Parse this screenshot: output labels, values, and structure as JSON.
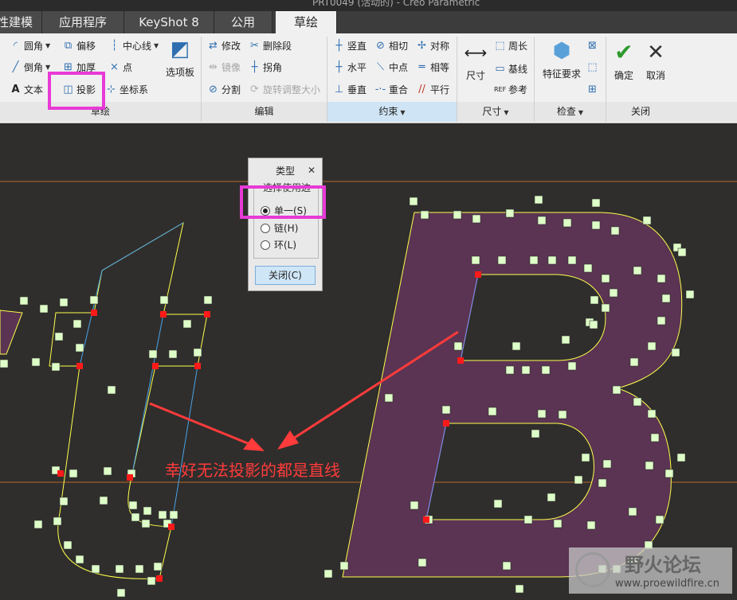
{
  "window": {
    "title": "PRT0049 (活动的) - Creo Parametric"
  },
  "tabs": [
    {
      "label": "柔性建模"
    },
    {
      "label": "应用程序"
    },
    {
      "label": "KeyShot 8"
    },
    {
      "label": "公用"
    },
    {
      "label": "草绘"
    }
  ],
  "ribbon": {
    "sketch_group": {
      "fillet": "圆角",
      "offset": "偏移",
      "centerline": "中心线",
      "chamfer": "倒角",
      "thicken": "加厚",
      "point": "点",
      "text": "文本",
      "project": "投影",
      "coord_sys": "坐标系",
      "palette": "选项板",
      "label": "草绘"
    },
    "edit_group": {
      "modify": "修改",
      "delete_segment": "删除段",
      "mirror": "镜像",
      "corner": "拐角",
      "divide": "分割",
      "rotate_resize": "旋转调整大小",
      "label": "编辑"
    },
    "constrain_group": {
      "vertical": "竖直",
      "tangent": "相切",
      "symmetric": "对称",
      "horizontal": "水平",
      "midpoint": "中点",
      "equal": "相等",
      "perpendicular": "垂直",
      "coincident": "重合",
      "parallel": "平行",
      "label": "约束"
    },
    "dimension_group": {
      "dimension": "尺寸",
      "perimeter": "周长",
      "baseline": "基线",
      "reference": "参考",
      "label": "尺寸"
    },
    "inspect_group": {
      "feature_req": "特征要求",
      "label": "检查"
    },
    "close_group": {
      "ok": "确定",
      "cancel": "取消",
      "label": "关闭"
    }
  },
  "dialog": {
    "title": "类型",
    "group_title": "选择使用边",
    "options": [
      {
        "label": "单一(S)",
        "selected": true
      },
      {
        "label": "链(H)",
        "selected": false
      },
      {
        "label": "环(L)",
        "selected": false
      }
    ],
    "close_button": "关闭(C)"
  },
  "annotation": {
    "text": "幸好无法投影的都是直线",
    "color": "#ff3b3b"
  },
  "watermark": {
    "brand": "野火论坛",
    "url": "www.proewildfire.cn"
  },
  "colors": {
    "highlight_box": "#e83ad6",
    "sketch_fill": "#5a3452",
    "sketch_line": "#ffff4d",
    "reference_line": "#b86a2a"
  }
}
